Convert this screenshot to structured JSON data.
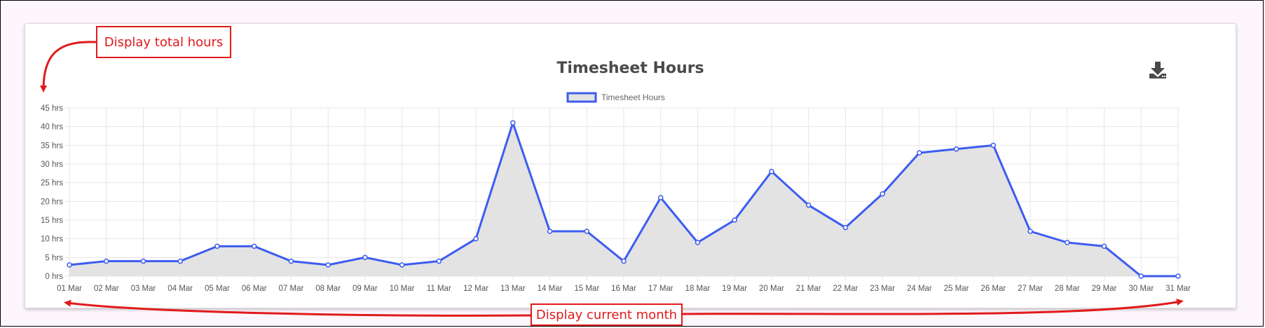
{
  "card": {
    "title": "Timesheet Hours",
    "download_icon": "download-icon"
  },
  "annotations": {
    "total_hours": "Display total hours",
    "current_month": "Display current month",
    "color": "#e01b1b"
  },
  "chart_data": {
    "type": "area",
    "title": "Timesheet Hours",
    "legend": {
      "position": "top",
      "entries": [
        "Timesheet Hours"
      ]
    },
    "x": [
      "01 Mar",
      "02 Mar",
      "03 Mar",
      "04 Mar",
      "05 Mar",
      "06 Mar",
      "07 Mar",
      "08 Mar",
      "09 Mar",
      "10 Mar",
      "11 Mar",
      "12 Mar",
      "13 Mar",
      "14 Mar",
      "15 Mar",
      "16 Mar",
      "17 Mar",
      "18 Mar",
      "19 Mar",
      "20 Mar",
      "21 Mar",
      "22 Mar",
      "23 Mar",
      "24 Mar",
      "25 Mar",
      "26 Mar",
      "27 Mar",
      "28 Mar",
      "29 Mar",
      "30 Mar",
      "31 Mar"
    ],
    "series": [
      {
        "name": "Timesheet Hours",
        "values": [
          3,
          4,
          4,
          4,
          8,
          8,
          4,
          3,
          5,
          3,
          4,
          10,
          41,
          12,
          12,
          4,
          21,
          9,
          15,
          28,
          19,
          13,
          22,
          33,
          34,
          35,
          12,
          9,
          8,
          0,
          0
        ],
        "color": "#3d5cf0",
        "fill": "#e3e3e3"
      }
    ],
    "y_ticks": [
      "0 hrs",
      "5 hrs",
      "10 hrs",
      "15 hrs",
      "20 hrs",
      "25 hrs",
      "30 hrs",
      "35 hrs",
      "40 hrs",
      "45 hrs"
    ],
    "ylim": [
      0,
      45
    ],
    "grid": true
  }
}
